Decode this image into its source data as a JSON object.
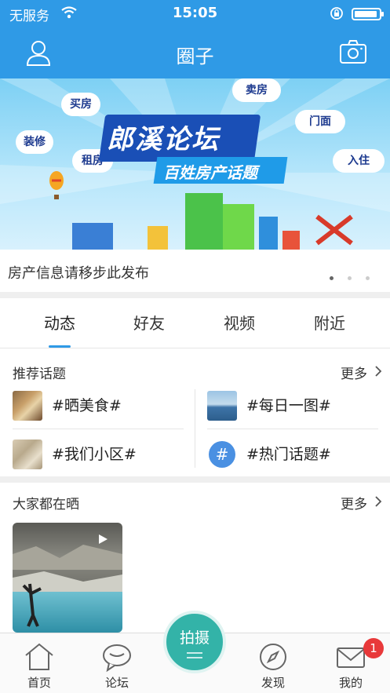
{
  "status_bar": {
    "carrier": "无服务",
    "time": "15:05",
    "battery_level": 0.92
  },
  "nav": {
    "title": "圈子"
  },
  "banner": {
    "title": "郎溪论坛",
    "subtitle": "百姓房产话题",
    "tags": [
      "买房",
      "卖房",
      "门面",
      "装修",
      "租房",
      "入住"
    ],
    "caption": "房产信息请移步此发布",
    "page_count": 3,
    "active_page": 1
  },
  "tabs": [
    {
      "label": "动态",
      "active": true
    },
    {
      "label": "好友",
      "active": false
    },
    {
      "label": "视频",
      "active": false
    },
    {
      "label": "附近",
      "active": false
    }
  ],
  "recommended_topics": {
    "title": "推荐话题",
    "more": "更多",
    "items": [
      {
        "label": "#晒美食#",
        "thumb": "food-photo"
      },
      {
        "label": "#每日一图#",
        "thumb": "sea-photo"
      },
      {
        "label": "#我们小区#",
        "thumb": "community-photo"
      },
      {
        "label": "#热门话题#",
        "thumb": "hash-icon"
      }
    ]
  },
  "everyone_sharing": {
    "title": "大家都在晒",
    "more": "更多"
  },
  "tab_bar": {
    "items": [
      {
        "label": "首页",
        "icon": "home-icon"
      },
      {
        "label": "论坛",
        "icon": "chat-bubble-icon"
      },
      {
        "label": "发现",
        "icon": "compass-icon"
      },
      {
        "label": "我的",
        "icon": "mail-icon"
      }
    ],
    "center_button": "拍摄",
    "badge": "1"
  },
  "colors": {
    "primary": "#2f9ae6",
    "accent": "#33b3a8",
    "badge": "#e8393a"
  }
}
